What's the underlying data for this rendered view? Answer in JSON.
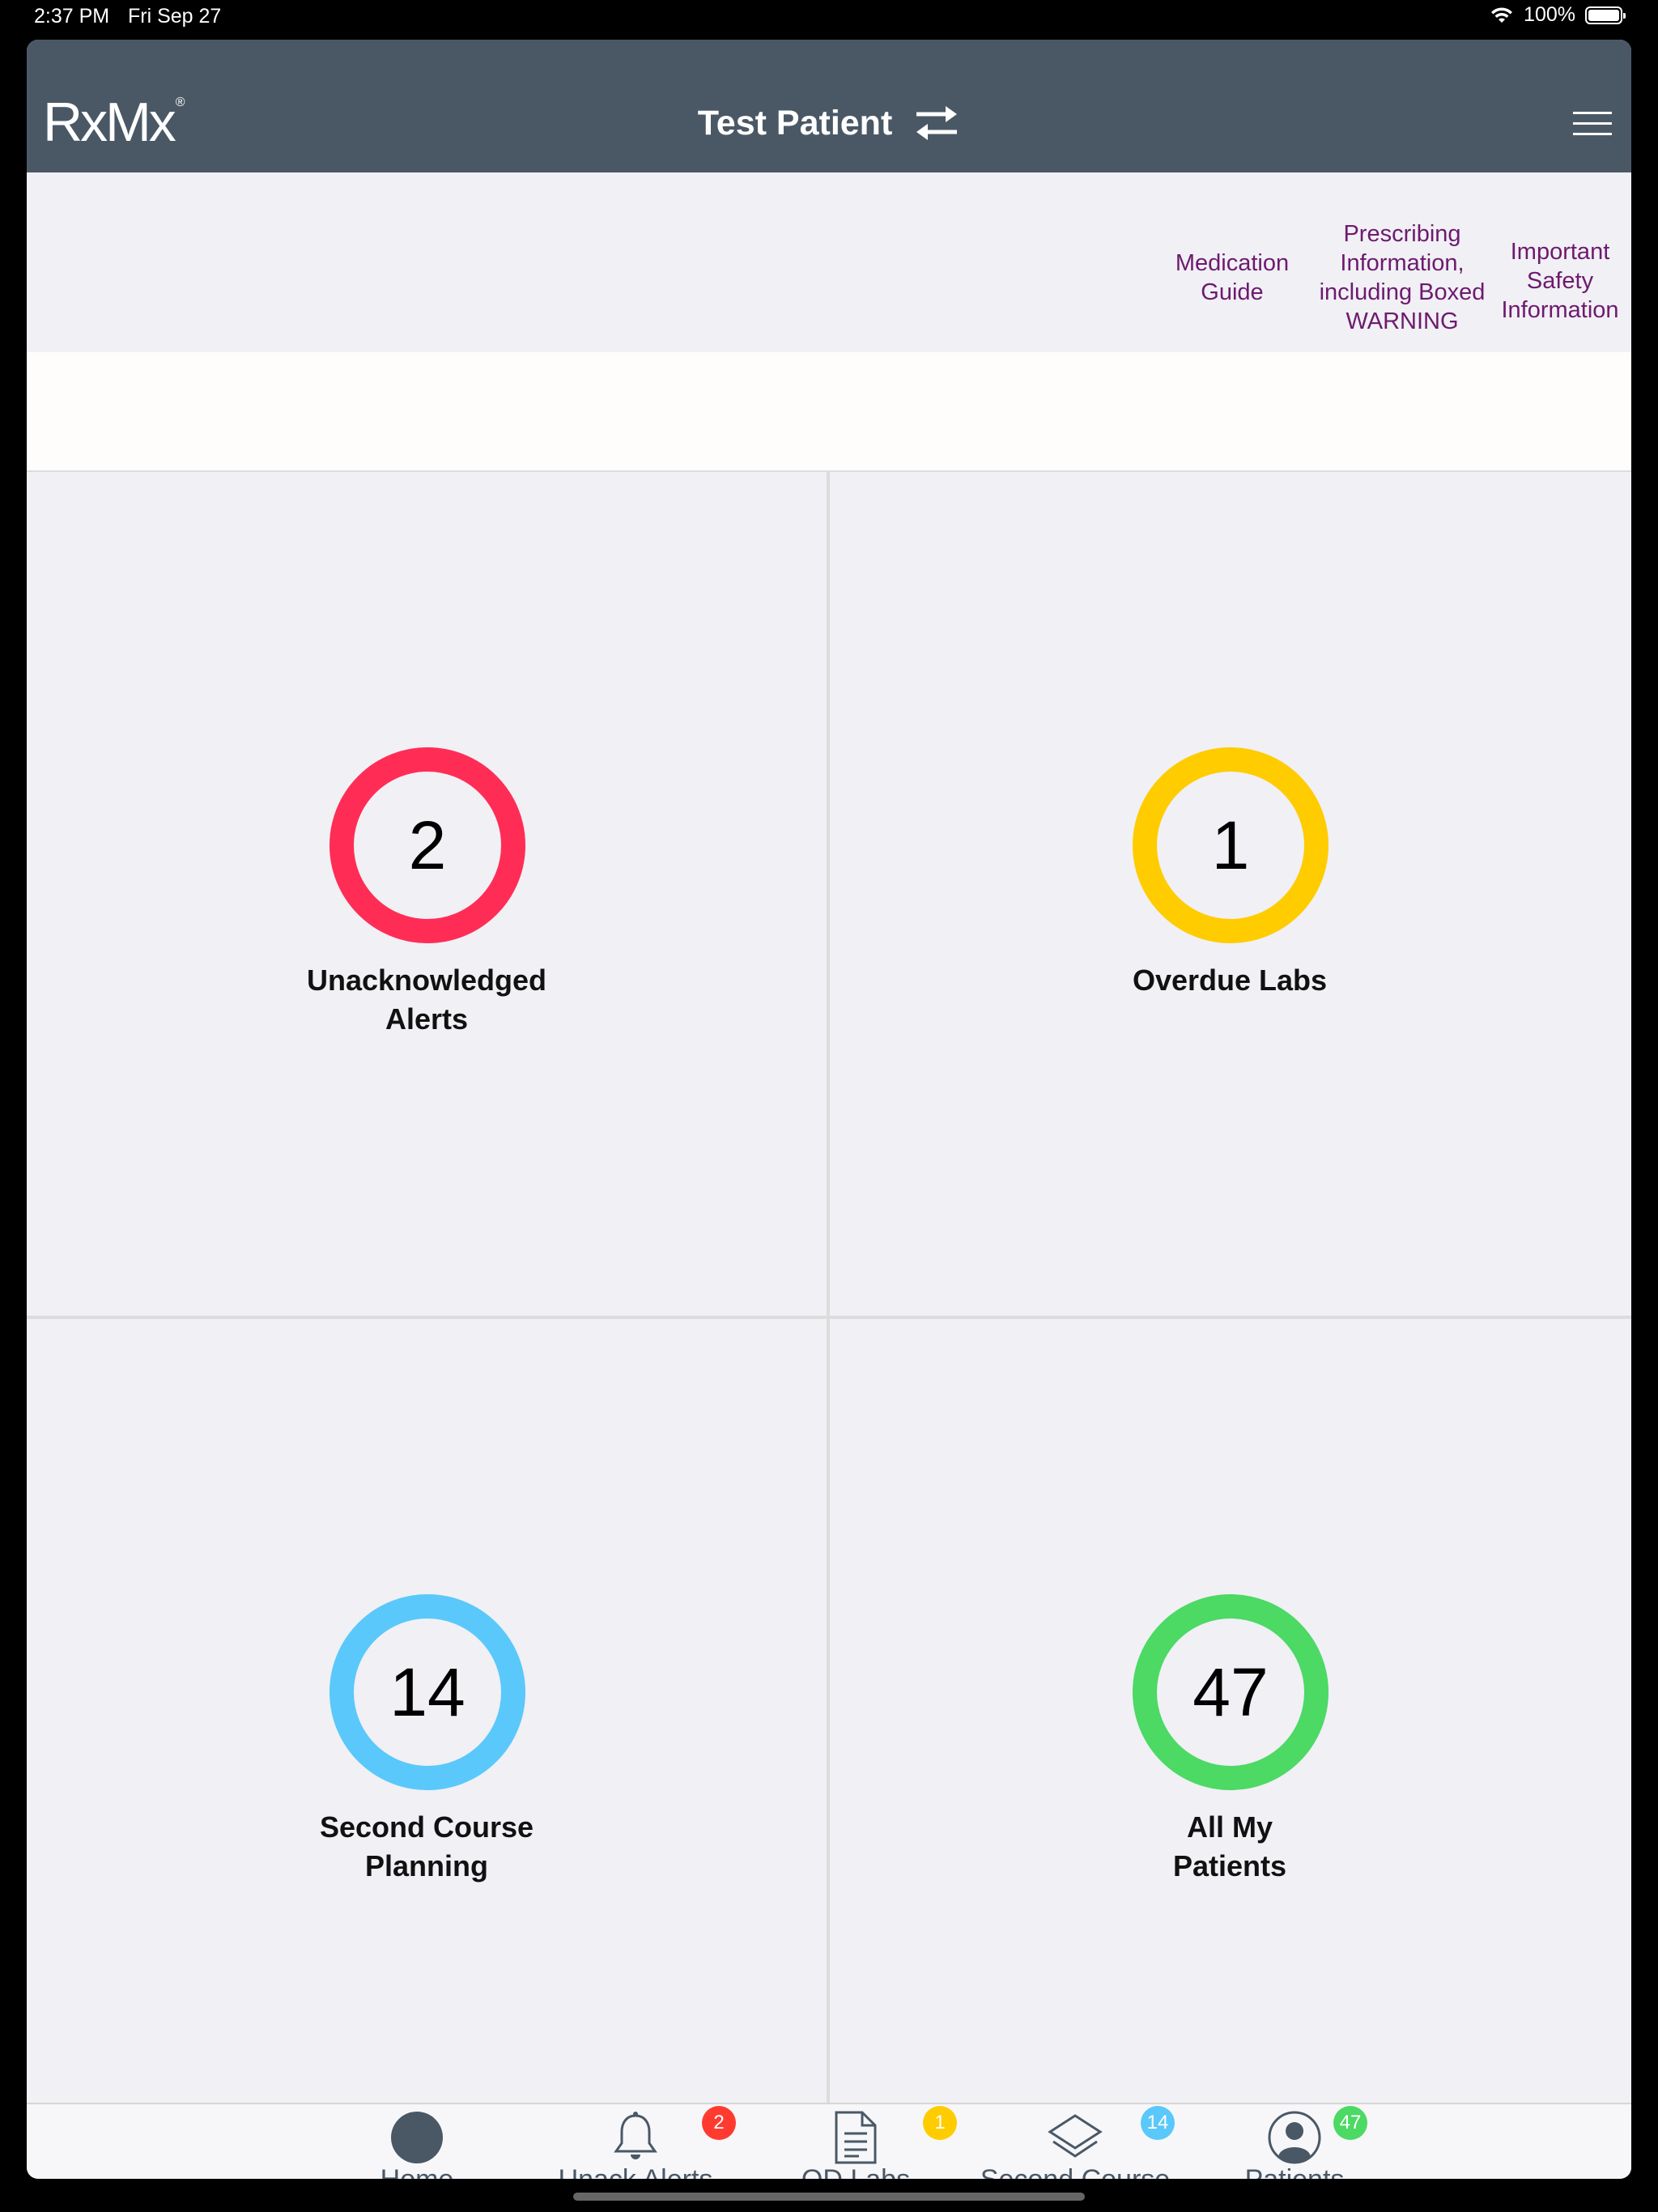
{
  "status_bar": {
    "time": "2:37 PM",
    "date": "Fri Sep 27",
    "battery": "100%"
  },
  "nav": {
    "logo": "RxMx",
    "logo_mark": "®",
    "title": "Test Patient"
  },
  "info_links": {
    "medication_guide": "Medication\nGuide",
    "prescribing_info": "Prescribing\nInformation,\nincluding Boxed\nWARNING",
    "safety_info": "Important\nSafety\nInformation"
  },
  "tiles": [
    {
      "count": "2",
      "label": "Unacknowledged\nAlerts",
      "color": "#ff2d55"
    },
    {
      "count": "1",
      "label": "Overdue Labs",
      "color": "#ffcc00"
    },
    {
      "count": "14",
      "label": "Second Course\nPlanning",
      "color": "#5ac8fa"
    },
    {
      "count": "47",
      "label": "All My\nPatients",
      "color": "#4cd964"
    }
  ],
  "tabs": [
    {
      "label": "Home",
      "icon": "home-circle-icon",
      "badge": ""
    },
    {
      "label": "Unack Alerts",
      "icon": "bell-icon",
      "badge": "2",
      "badge_color": "#ff3b30"
    },
    {
      "label": "OD Labs",
      "icon": "document-icon",
      "badge": "1",
      "badge_color": "#ffcc00"
    },
    {
      "label": "Second Course",
      "icon": "layers-icon",
      "badge": "14",
      "badge_color": "#5ac8fa"
    },
    {
      "label": "Patients",
      "icon": "person-icon",
      "badge": "47",
      "badge_color": "#4cd964"
    }
  ],
  "colors": {
    "nav_bg": "#4a5866",
    "link": "#6e1a6e"
  }
}
